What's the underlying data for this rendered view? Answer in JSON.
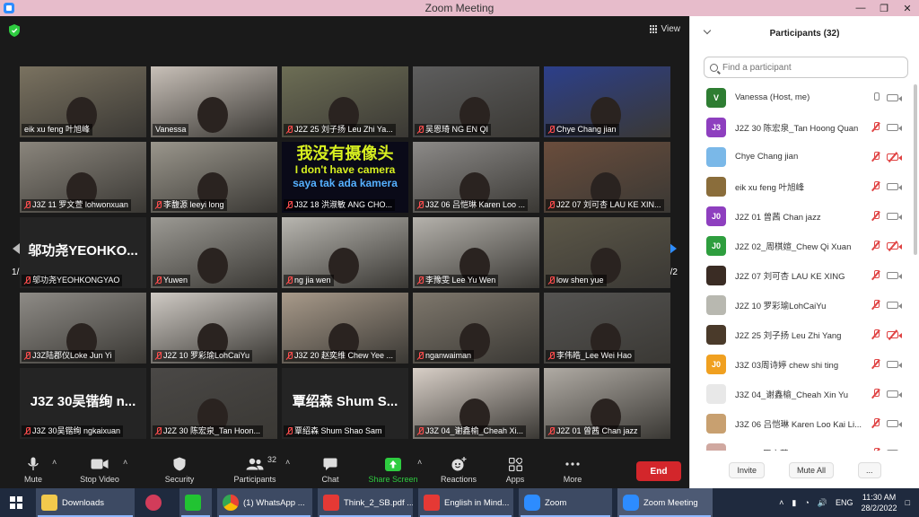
{
  "window": {
    "title": "Zoom Meeting"
  },
  "view_label": "View",
  "pagination": {
    "left": "1/2",
    "right": "1/2"
  },
  "tiles": [
    {
      "name": "eik xu feng 叶旭峰",
      "muted": false,
      "bg": "#7a7260"
    },
    {
      "name": "Vanessa",
      "muted": false,
      "active": true,
      "bg": "#c8c0b8"
    },
    {
      "name": "J2Z 25 刘子扬 Leu Zhi Ya...",
      "muted": true,
      "bg": "#6d6e55"
    },
    {
      "name": "吴恩琦 NG EN QI",
      "muted": true,
      "bg": "#5e5e5e"
    },
    {
      "name": "Chye Chang jian",
      "muted": true,
      "bg": "#2c3f8a"
    },
    {
      "name": "J3Z 11 罗文萱 lohwonxuan",
      "muted": true,
      "bg": "#8a857c"
    },
    {
      "name": "李馥源 leeyi long",
      "muted": true,
      "bg": "#9a968c"
    },
    {
      "name": "J3Z 18 洪淑敏 ANG CHO...",
      "muted": true,
      "camera_text": true
    },
    {
      "name": "J3Z 06 吕恺琳 Karen Loo ...",
      "muted": true,
      "bg": "#8c8a88"
    },
    {
      "name": "J2Z 07 刘可杏 LAU KE XIN...",
      "muted": true,
      "bg": "#6a4d3c"
    },
    {
      "name": "邬功尧YEOHKONGYAO",
      "big": "邬功尧YEOHKO...",
      "muted": true
    },
    {
      "name": "Yuwen",
      "muted": true,
      "bg": "#9c9a94"
    },
    {
      "name": "ng jia wen",
      "muted": true,
      "bg": "#b8b6b0"
    },
    {
      "name": "李豫雯 Lee Yu Wen",
      "muted": true,
      "bg": "#b5b2ac"
    },
    {
      "name": "low shen yue",
      "muted": true,
      "bg": "#5c5748"
    },
    {
      "name": "J3Z陆郡仪Loke Jun Yi",
      "muted": true,
      "bg": "#8e8b86"
    },
    {
      "name": "J2Z 10 罗彩瑜LohCaiYu",
      "muted": true,
      "bg": "#cfcac4"
    },
    {
      "name": "J3Z 20 赵奕维 Chew Yee ...",
      "muted": true,
      "bg": "#a89a8a"
    },
    {
      "name": "nganwaiman",
      "muted": true,
      "bg": "#7e776c"
    },
    {
      "name": "李伟皓_Lee Wei Hao",
      "muted": true,
      "bg": "#555452"
    },
    {
      "name": "J3Z 30吴锴绚 ngkaixuan",
      "big": "J3Z 30吴锴绚 n...",
      "muted": true
    },
    {
      "name": "J2Z 30 陈宏泉_Tan Hoon...",
      "muted": true,
      "bg": "#4a4846"
    },
    {
      "name": "覃绍森 Shum Shao Sam",
      "big": "覃绍森 Shum S...",
      "muted": true
    },
    {
      "name": "J3Z 04_谢鑫榆_Cheah Xi...",
      "muted": true,
      "bg": "#d8cfc7"
    },
    {
      "name": "J2Z 01 曾茜 Chan jazz",
      "muted": true,
      "bg": "#b0aba4"
    }
  ],
  "camera_text": {
    "line1": "我没有摄像头",
    "line2": "I don't have camera",
    "line3": "saya tak ada kamera"
  },
  "toolbar": {
    "mute": "Mute",
    "stop_video": "Stop Video",
    "security": "Security",
    "participants": "Participants",
    "participants_count": "32",
    "chat": "Chat",
    "share_screen": "Share Screen",
    "reactions": "Reactions",
    "apps": "Apps",
    "more": "More",
    "end": "End"
  },
  "panel": {
    "title": "Participants (32)",
    "search_placeholder": "Find a participant",
    "invite": "Invite",
    "mute_all": "Mute All",
    "more": "..."
  },
  "participants": [
    {
      "name": "Vanessa (Host, me)",
      "avatar": "V",
      "color": "#2e7d32",
      "mic_off": false,
      "cam_off": false
    },
    {
      "name": "J2Z 30 陈宏泉_Tan Hoong Quan",
      "avatar": "J3",
      "color": "#8e3fbf",
      "mic_off": true,
      "cam_off": false
    },
    {
      "name": "Chye Chang jian",
      "avatar": "",
      "color": "#7ab8e8",
      "mic_off": true,
      "cam_off": true
    },
    {
      "name": "eik xu feng 叶旭峰",
      "avatar": "",
      "color": "#8a6d3b",
      "mic_off": true,
      "cam_off": false
    },
    {
      "name": "J2Z 01 曾茜 Chan jazz",
      "avatar": "J0",
      "color": "#8e3fbf",
      "mic_off": true,
      "cam_off": false
    },
    {
      "name": "J2Z 02_周棋媗_Chew Qi Xuan",
      "avatar": "J0",
      "color": "#2e9e3e",
      "mic_off": true,
      "cam_off": true
    },
    {
      "name": "J2Z 07 刘可杏 LAU KE XING",
      "avatar": "",
      "color": "#3a2c24",
      "mic_off": true,
      "cam_off": false
    },
    {
      "name": "J2Z 10 罗彩瑜LohCaiYu",
      "avatar": "",
      "color": "#b8b8b0",
      "mic_off": true,
      "cam_off": false
    },
    {
      "name": "J2Z 25 刘子扬 Leu Zhi Yang",
      "avatar": "",
      "color": "#4a3a2a",
      "mic_off": true,
      "cam_off": true
    },
    {
      "name": "J3Z 03周诗婷 chew shi ting",
      "avatar": "J0",
      "color": "#f0a020",
      "mic_off": true,
      "cam_off": false
    },
    {
      "name": "J3Z 04_谢鑫榆_Cheah Xin Yu",
      "avatar": "",
      "color": "#e8e8e8",
      "mic_off": true,
      "cam_off": false
    },
    {
      "name": "J3Z 06 吕恺琳 Karen Loo Kai Li...",
      "avatar": "",
      "color": "#c8a070",
      "mic_off": true,
      "cam_off": false
    },
    {
      "name": "J3Z 11 罗文萱 lohwonxuan",
      "avatar": "",
      "color": "#d0a8a0",
      "mic_off": true,
      "cam_off": false
    }
  ],
  "taskbar": {
    "items": [
      "Downloads",
      "",
      "",
      "(1) WhatsApp ...",
      "Think_2_SB.pdf ...",
      "English in Mind...",
      "Zoom",
      "Zoom Meeting"
    ],
    "lang": "ENG",
    "time": "11:30 AM",
    "date": "28/2/2022"
  }
}
